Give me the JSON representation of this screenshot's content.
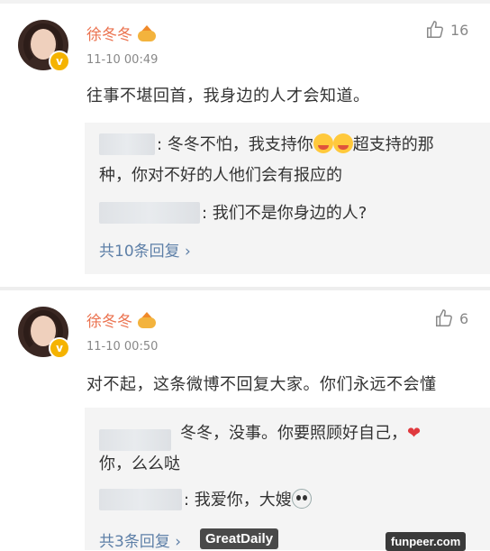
{
  "comments": [
    {
      "name": "徐冬冬",
      "time": "11-10 00:49",
      "likes": "16",
      "content": "往事不堪回首，我身边的人才会知道。",
      "replies": [
        {
          "line1": ": 冬冬不怕，我支持你",
          "line1b": "超支持的那",
          "line2": "种，你对不好的人他们会有报应的"
        },
        {
          "line1": ": 我们不是你身边的人?"
        }
      ],
      "more": "共10条回复 ›"
    },
    {
      "name": "徐冬冬",
      "time": "11-10 00:50",
      "likes": "6",
      "content": "对不起，这条微博不回复大家。你们永远不会懂",
      "replies": [
        {
          "line1": "冬冬，没事。你要照顾好自己，",
          "line2": "你，么么哒"
        },
        {
          "line1": ": 我爱你，大嫂"
        }
      ],
      "more": "共3条回复 ›"
    }
  ],
  "watermarks": {
    "left": "GreatDaily",
    "right": "funpeer.com"
  },
  "colors": {
    "name": "#eb7350",
    "link": "#5d7fa7",
    "badge": "#f5b300"
  }
}
